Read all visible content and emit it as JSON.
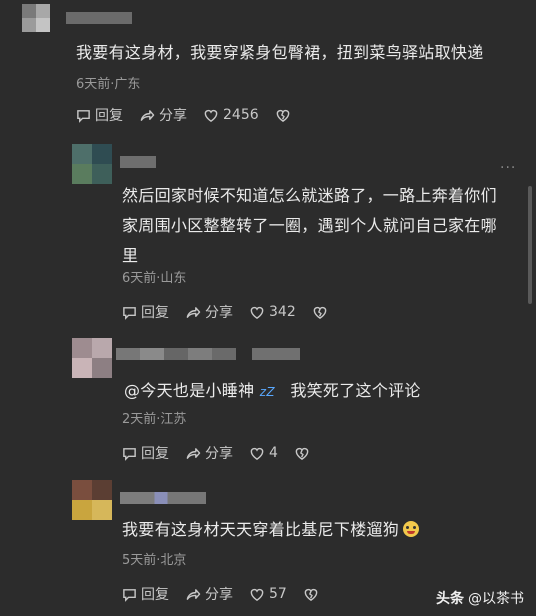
{
  "comments": [
    {
      "text": "我要有这身材，我要穿紧身包臀裙，扭到菜鸟驿站取快递",
      "meta": "6天前·广东",
      "reply": "回复",
      "share": "分享",
      "likes": "2456"
    },
    {
      "text_line1": "然后回家时候不知道怎么就迷路了，一路上奔着你们",
      "text_line2": "家周围小区整整转了一圈，遇到个人就问自己家在哪",
      "text_line3": "里",
      "meta": "6天前·山东",
      "reply": "回复",
      "share": "分享",
      "likes": "342"
    },
    {
      "text_prefix": "@今天也是小睡神",
      "text_emoji": "zZ",
      "text_suffix": "我笑死了这个评论",
      "meta": "2天前·江苏",
      "reply": "回复",
      "share": "分享",
      "likes": "4"
    },
    {
      "text": "我要有这身材天天穿着比基尼下楼遛狗",
      "meta": "5天前·北京",
      "reply": "回复",
      "share": "分享",
      "likes": "57"
    }
  ],
  "more_menu": "···",
  "watermark": {
    "logo": "头条",
    "account": "@以茶书"
  },
  "colors": {
    "background": "#2c2c2c",
    "text": "#ebebeb",
    "meta": "#9a9a9a"
  }
}
